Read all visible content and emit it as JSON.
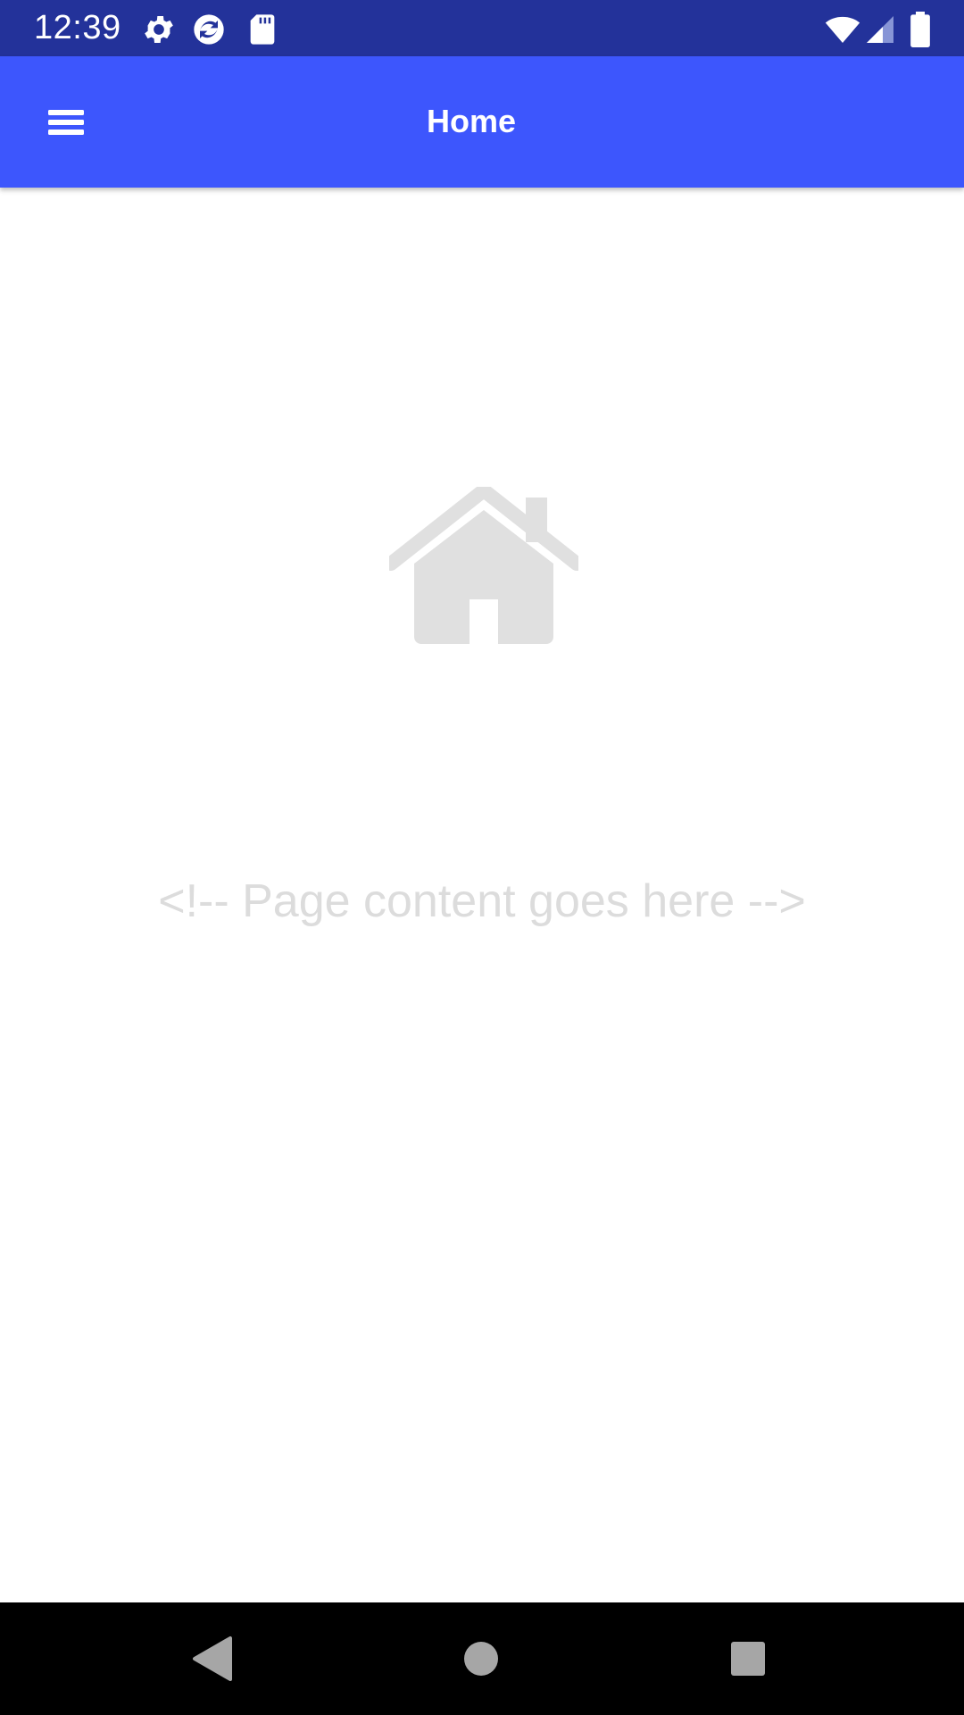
{
  "status_bar": {
    "time": "12:39",
    "left_icons": [
      "settings-icon",
      "sync-app-icon",
      "sd-card-icon"
    ],
    "right_icons": [
      "wifi-icon",
      "cell-signal-icon",
      "battery-icon"
    ]
  },
  "app_bar": {
    "title": "Home",
    "menu_icon": "hamburger-menu-icon"
  },
  "content": {
    "illustration_icon": "home-icon",
    "placeholder": "<!-- Page content goes here -->"
  },
  "nav_bar": {
    "buttons": [
      "back-icon",
      "home-circle-icon",
      "recents-icon"
    ]
  },
  "colors": {
    "status_bar": "#23329a",
    "app_bar": "#3d56fd",
    "placeholder_gray": "#dcdcdc",
    "nav_bar": "#000000"
  }
}
